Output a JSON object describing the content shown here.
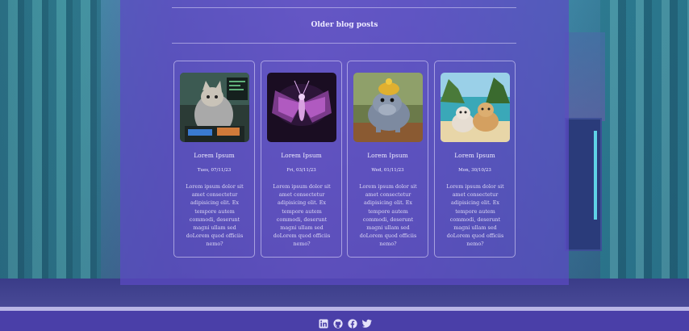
{
  "section": {
    "title": "Older blog posts"
  },
  "posts": [
    {
      "title": "Lorem Ipsum",
      "date": "Tues, 07/11/23",
      "excerpt": "Lorem ipsum dolor sit amet consectetur adipisicing elit. Ex tempore autem commodi, deserunt magni ullam sed doLorem quod officiis nemo?",
      "image": "cat-hacker-image"
    },
    {
      "title": "Lorem Ipsum",
      "date": "Fri, 03/11/23",
      "excerpt": "Lorem ipsum dolor sit amet consectetur adipisicing elit. Ex tempore autem commodi, deserunt magni ullam sed doLorem quod officiis nemo?",
      "image": "moth-image"
    },
    {
      "title": "Lorem Ipsum",
      "date": "Wed, 01/11/23",
      "excerpt": "Lorem ipsum dolor sit amet consectetur adipisicing elit. Ex tempore autem commodi, deserunt magni ullam sed doLorem quod officiis nemo?",
      "image": "hippo-image"
    },
    {
      "title": "Lorem Ipsum",
      "date": "Mon, 30/10/23",
      "excerpt": "Lorem ipsum dolor sit amet consectetur adipisicing elit. Ex tempore autem commodi, deserunt magni ullam sed doLorem quod officiis nemo?",
      "image": "cats-beach-image"
    }
  ],
  "footer": {
    "social": [
      "linkedin-icon",
      "github-icon",
      "facebook-icon",
      "twitter-icon"
    ]
  },
  "colors": {
    "panel": "#5c4ac4",
    "footer": "#4a3fa8",
    "text": "#f0edff"
  }
}
